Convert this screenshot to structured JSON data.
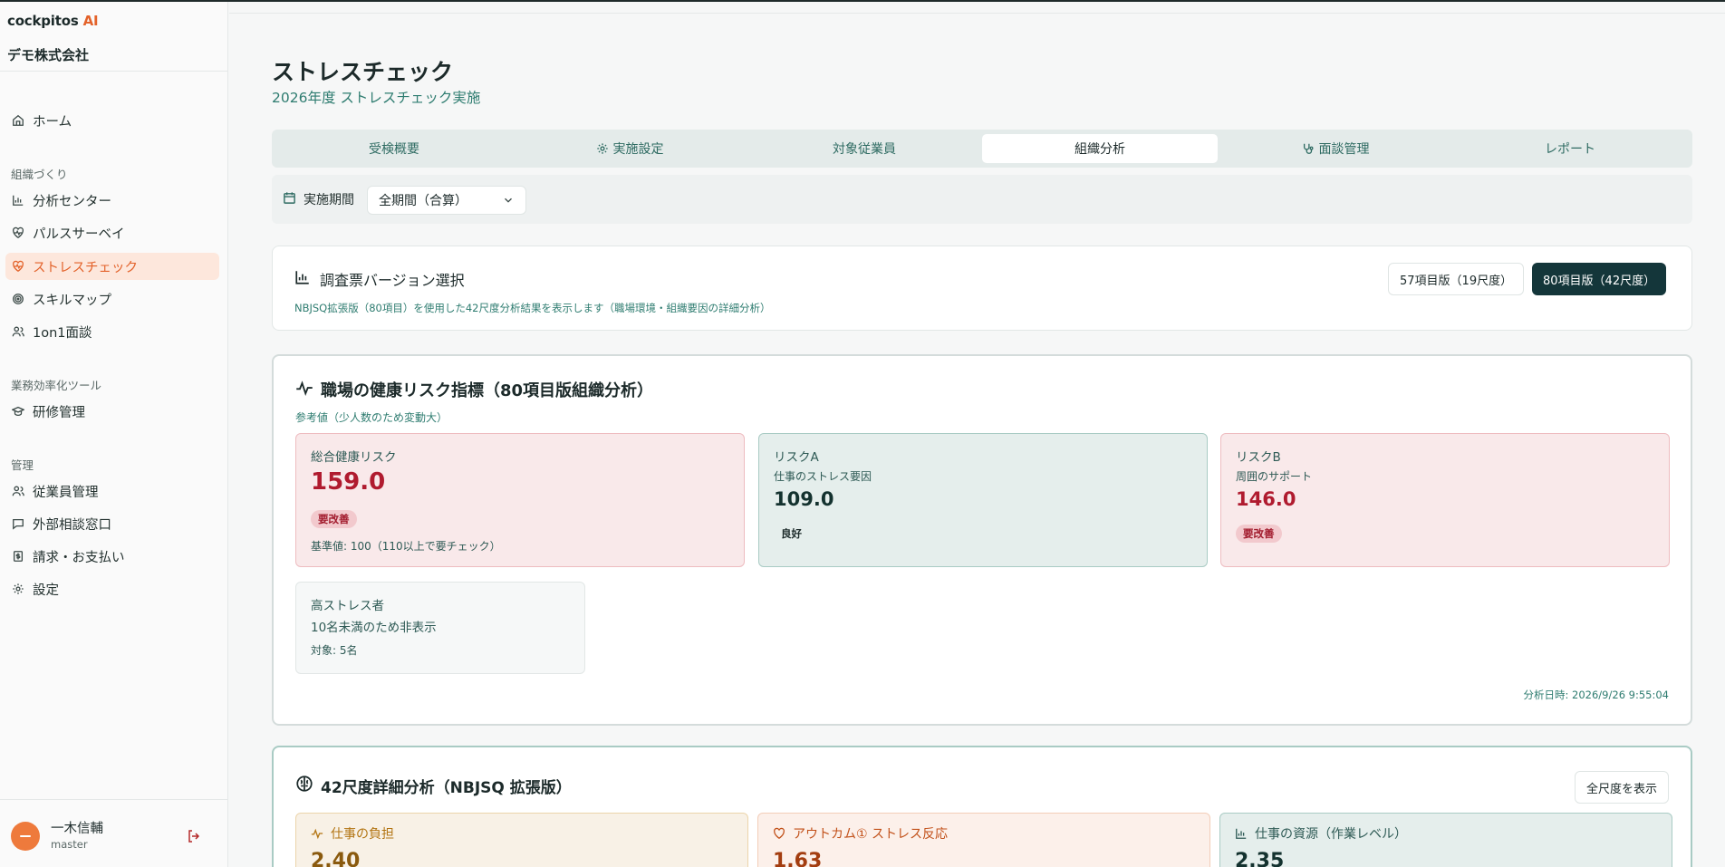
{
  "app": {
    "logo_text": "cockpitos",
    "logo_accent": "AI",
    "company": "デモ株式会社"
  },
  "sidebar": {
    "home": "ホーム",
    "section_org": "組織づくり",
    "org_items": [
      "分析センター",
      "パルスサーベイ",
      "ストレスチェック",
      "スキルマップ",
      "1on1面談"
    ],
    "section_tools": "業務効率化ツール",
    "tool_items": [
      "研修管理"
    ],
    "section_admin": "管理",
    "admin_items": [
      "従業員管理",
      "外部相談窓口",
      "請求・お支払い",
      "設定"
    ]
  },
  "user": {
    "name": "一木信輔",
    "role": "master"
  },
  "page": {
    "title": "ストレスチェック",
    "subtitle": "2026年度 ストレスチェック実施"
  },
  "tabs": [
    {
      "label": "受検概要",
      "active": false
    },
    {
      "label": "実施設定",
      "active": false
    },
    {
      "label": "対象従業員",
      "active": false
    },
    {
      "label": "組織分析",
      "active": true
    },
    {
      "label": "面談管理",
      "active": false
    },
    {
      "label": "レポート",
      "active": false
    }
  ],
  "filter": {
    "label": "実施期間",
    "selected": "全期間（合算）"
  },
  "version": {
    "title": "調査票バージョン選択",
    "description": "NBJSQ拡張版（80項目）を使用した42尺度分析結果を表示します（職場環境・組織要因の詳細分析）",
    "option_57": "57項目版（19尺度）",
    "option_80": "80項目版（42尺度）",
    "selected": "80"
  },
  "risk": {
    "title": "職場の健康リスク指標（80項目版組織分析）",
    "subtitle": "参考値（少人数のため変動大）",
    "total": {
      "label": "総合健康リスク",
      "value": "159.0",
      "badge": "要改善",
      "note": "基準値: 100（110以上で要チェック）"
    },
    "risk_a": {
      "label": "リスクA",
      "sub": "仕事のストレス要因",
      "value": "109.0",
      "badge": "良好"
    },
    "risk_b": {
      "label": "リスクB",
      "sub": "周囲のサポート",
      "value": "146.0",
      "badge": "要改善"
    },
    "high_stress": {
      "label": "高ストレス者",
      "message": "10名未満のため非表示",
      "target": "対象: 5名"
    },
    "analysis_date": "分析日時: 2026/9/26 9:55:04"
  },
  "detail": {
    "title": "42尺度詳細分析（NBJSQ 拡張版）",
    "show_all": "全尺度を表示",
    "scales": [
      {
        "label": "仕事の負担",
        "value": "2.40"
      },
      {
        "label": "アウトカム① ストレス反応",
        "value": "1.63"
      },
      {
        "label": "仕事の資源（作業レベル）",
        "value": "2.35"
      }
    ]
  },
  "colors": {
    "accent": "#e3622a",
    "teal": "#2e7c70",
    "dark_button": "#14363a",
    "warn": "#b01b2f"
  }
}
